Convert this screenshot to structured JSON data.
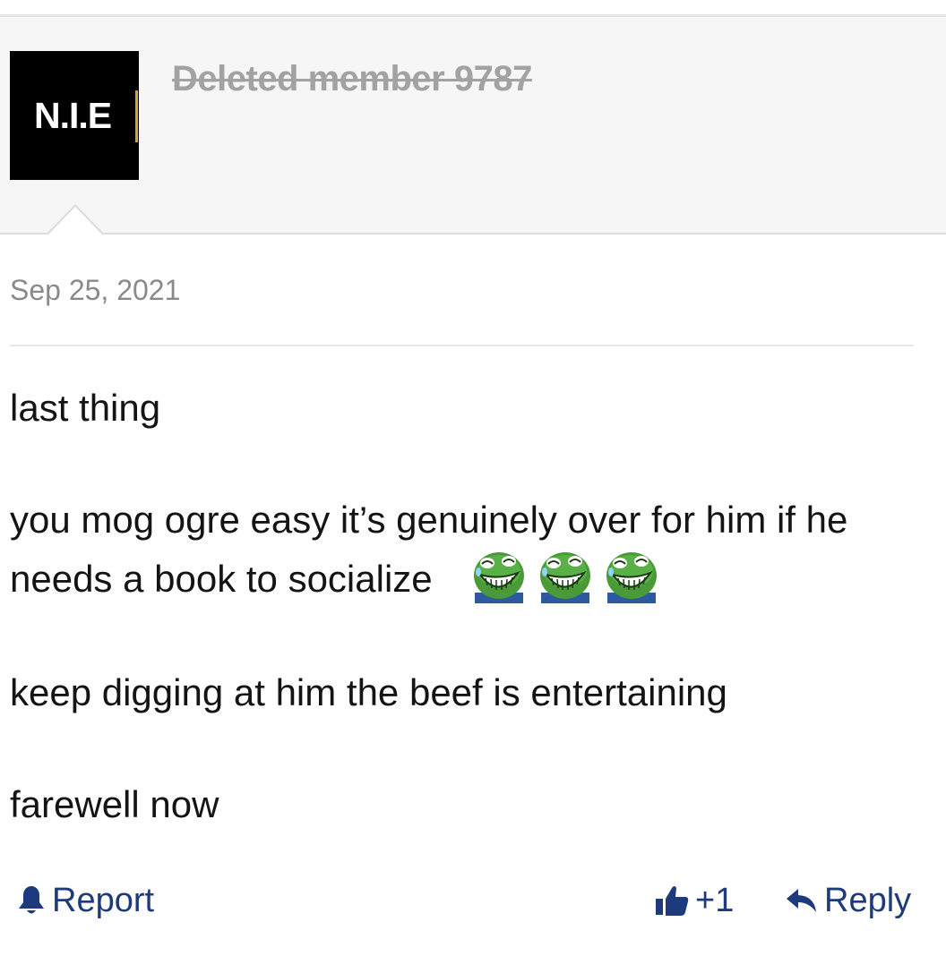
{
  "post": {
    "author": {
      "avatar_text": "N.I.E",
      "name": "Deleted member 9787"
    },
    "date": "Sep 25, 2021",
    "lines": [
      "last thing",
      "you mog ogre easy it’s genuinely over for him if he",
      "needs a book to socialize",
      "keep digging at him the beef is entertaining",
      "farewell now"
    ],
    "emojis": [
      "laughing-pepe-emoji",
      "laughing-pepe-emoji",
      "laughing-pepe-emoji"
    ]
  },
  "actions": {
    "report_label": "Report",
    "like_count": "+1",
    "reply_label": "Reply"
  },
  "icons": {
    "report": "alarm-bell-icon",
    "like": "thumbs-up-icon",
    "reply": "reply-arrow-icon"
  },
  "colors": {
    "action_link": "#1d3a7d",
    "header_bg": "#f6f6f6",
    "avatar_accent": "#d4a62a",
    "username": "#a2a2a2",
    "date": "#8a8a8a"
  }
}
